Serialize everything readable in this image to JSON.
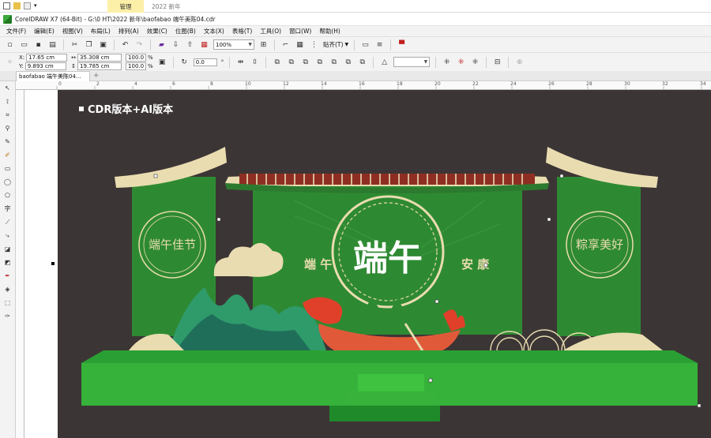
{
  "explorer": {
    "context_tab": "管理",
    "next_tab": "2022 新年"
  },
  "window": {
    "title": "CorelDRAW X7 (64-Bit) - G:\\0 HT\\2022 新年\\baofabao 端午美陈04.cdr"
  },
  "menu": {
    "items": [
      "文件(F)",
      "编辑(E)",
      "视图(V)",
      "布局(L)",
      "排列(A)",
      "效果(C)",
      "位图(B)",
      "文本(X)",
      "表格(T)",
      "工具(O)",
      "窗口(W)",
      "帮助(H)"
    ]
  },
  "toolbar": {
    "zoom": "100%",
    "snap_label": "贴齐(T)"
  },
  "properties": {
    "x": "17.65 cm",
    "y": "9.893 cm",
    "w": "35.308 cm",
    "h": "19.785 cm",
    "scale_x": "100.0",
    "scale_y": "100.0",
    "pct": "%",
    "rotation": "0.0",
    "deg": "°"
  },
  "document": {
    "tab_label": "baofabao 端午美陈04...",
    "add_tab": "+"
  },
  "ruler": {
    "labels": [
      "0",
      "2",
      "4",
      "6",
      "8",
      "10",
      "12",
      "14",
      "16",
      "18",
      "20",
      "22",
      "24",
      "26",
      "28",
      "30",
      "32",
      "34"
    ]
  },
  "artwork": {
    "note": "CDR版本+AI版本",
    "left_badge": "端午佳节",
    "right_badge": "粽享美好",
    "left_slogan": "端 午",
    "right_slogan": "安 康",
    "center_glyph": "端午"
  },
  "colors": {
    "artboard_bg": "#3c3535",
    "green_main": "#2f8a2f",
    "green_dark": "#1f6e2a",
    "gold": "#e8d8a8",
    "roof_red": "#9a3a2a",
    "platform": "#3db53d",
    "dragon_red": "#e05a3a"
  }
}
